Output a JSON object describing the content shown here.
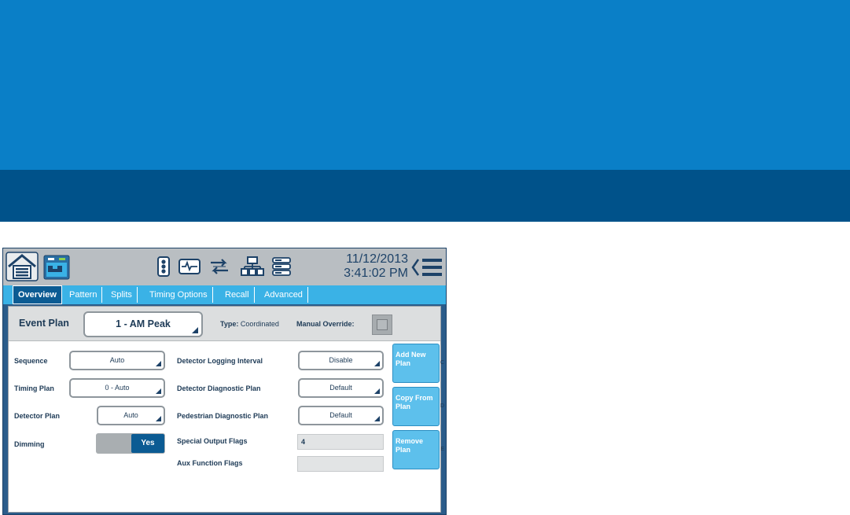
{
  "colors": {
    "banner_top": "#0a7fc7",
    "banner_bottom": "#00528a",
    "device_frame": "#2b5c8a",
    "tab_bar": "#3ab2e6",
    "active_tab": "#0b5b93",
    "side_button": "#5dc0ec"
  },
  "topbar": {
    "icons": [
      "home-icon",
      "controller-app-icon",
      "signal-light-icon",
      "waveform-icon",
      "transfer-arrows-icon",
      "network-icon",
      "storage-list-icon",
      "back-chevron-icon",
      "hamburger-menu-icon"
    ],
    "date": "11/12/2013",
    "time": "3:41:02 PM"
  },
  "tabs": [
    {
      "label": "Overview",
      "active": true
    },
    {
      "label": "Pattern",
      "active": false
    },
    {
      "label": "Splits",
      "active": false
    },
    {
      "label": "Timing Options",
      "active": false
    },
    {
      "label": "Recall",
      "active": false
    },
    {
      "label": "Advanced",
      "active": false
    }
  ],
  "plan": {
    "event_plan_label": "Event Plan",
    "event_plan_value": "1 - AM Peak",
    "type_label": "Type:",
    "type_value": "Coordinated",
    "manual_override_label": "Manual Override:"
  },
  "left": {
    "sequence_label": "Sequence",
    "sequence_value": "Auto",
    "timing_plan_label": "Timing Plan",
    "timing_plan_value": "0 - Auto",
    "detector_plan_label": "Detector Plan",
    "detector_plan_value": "Auto",
    "dimming_label": "Dimming",
    "dimming_value": "Yes"
  },
  "right": {
    "logging_label": "Detector Logging Interval",
    "logging_value": "Disable",
    "diag_label": "Detector Diagnostic Plan",
    "diag_value": "Default",
    "ped_label": "Pedestrian Diagnostic Plan",
    "ped_value": "Default",
    "special_label": "Special Output Flags",
    "special_value": "4",
    "aux_label": "Aux Function Flags",
    "aux_value": ""
  },
  "buttons": {
    "add_line1": "Add New",
    "add_line2": "Plan",
    "add_key": "C",
    "copy_line1": "Copy From",
    "copy_line2": "Plan",
    "copy_key": "D",
    "remove_line1": "Remove",
    "remove_line2": "Plan",
    "remove_key": "E"
  }
}
